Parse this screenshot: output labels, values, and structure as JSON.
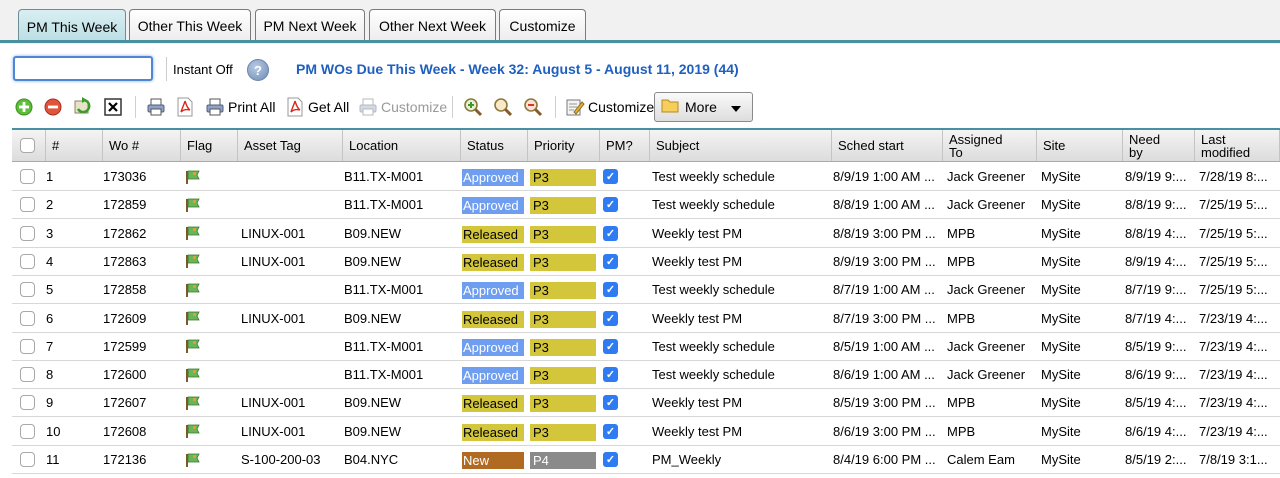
{
  "tabs": [
    {
      "label": "PM This Week",
      "active": true
    },
    {
      "label": "Other This Week",
      "active": false
    },
    {
      "label": "PM Next Week",
      "active": false
    },
    {
      "label": "Other Next Week",
      "active": false
    },
    {
      "label": "Customize",
      "active": false
    }
  ],
  "search": {
    "value": "",
    "placeholder": ""
  },
  "instant_label": "Instant Off",
  "help_label": "?",
  "title": "PM WOs Due This Week - Week 32: August 5 - August 11, 2019 (44)",
  "toolbar": {
    "print_all": "Print All",
    "get_all": "Get All",
    "customize_disabled": "Customize",
    "customize": "Customize",
    "more": "More"
  },
  "columns": {
    "num": "#",
    "wo": "Wo #",
    "flag": "Flag",
    "asset": "Asset Tag",
    "location": "Location",
    "status": "Status",
    "priority": "Priority",
    "pm": "PM?",
    "subject": "Subject",
    "sched": "Sched start",
    "assigned_1": "Assigned",
    "assigned_2": "To",
    "site": "Site",
    "need_1": "Need",
    "need_2": "by",
    "last_1": "Last",
    "last_2": "modified"
  },
  "colors": {
    "approved": "#6f9ef0",
    "released": "#d4c63b",
    "new": "#b06a22",
    "p3": "#d4c63b",
    "p4": "#8a8a8a",
    "accent": "#4a90a0",
    "title": "#1f5fbf"
  },
  "rows": [
    {
      "num": "1",
      "wo": "173036",
      "asset": "",
      "location": "B11.TX-M001",
      "status": "Approved",
      "priority": "P3",
      "subject": "Test weekly schedule",
      "sched": "8/9/19 1:00 AM ...",
      "assigned": "Jack Greener",
      "site": "MySite",
      "need": "8/9/19 9:...",
      "last": "7/28/19 8:..."
    },
    {
      "num": "2",
      "wo": "172859",
      "asset": "",
      "location": "B11.TX-M001",
      "status": "Approved",
      "priority": "P3",
      "subject": "Test weekly schedule",
      "sched": "8/8/19 1:00 AM ...",
      "assigned": "Jack Greener",
      "site": "MySite",
      "need": "8/8/19 9:...",
      "last": "7/25/19 5:..."
    },
    {
      "num": "3",
      "wo": "172862",
      "asset": "LINUX-001",
      "location": "B09.NEW",
      "status": "Released",
      "priority": "P3",
      "subject": "Weekly test PM",
      "sched": "8/8/19 3:00 PM ...",
      "assigned": "MPB",
      "site": "MySite",
      "need": "8/8/19 4:...",
      "last": "7/25/19 5:..."
    },
    {
      "num": "4",
      "wo": "172863",
      "asset": "LINUX-001",
      "location": "B09.NEW",
      "status": "Released",
      "priority": "P3",
      "subject": "Weekly test PM",
      "sched": "8/9/19 3:00 PM ...",
      "assigned": "MPB",
      "site": "MySite",
      "need": "8/9/19 4:...",
      "last": "7/25/19 5:..."
    },
    {
      "num": "5",
      "wo": "172858",
      "asset": "",
      "location": "B11.TX-M001",
      "status": "Approved",
      "priority": "P3",
      "subject": "Test weekly schedule",
      "sched": "8/7/19 1:00 AM ...",
      "assigned": "Jack Greener",
      "site": "MySite",
      "need": "8/7/19 9:...",
      "last": "7/25/19 5:..."
    },
    {
      "num": "6",
      "wo": "172609",
      "asset": "LINUX-001",
      "location": "B09.NEW",
      "status": "Released",
      "priority": "P3",
      "subject": "Weekly test PM",
      "sched": "8/7/19 3:00 PM ...",
      "assigned": "MPB",
      "site": "MySite",
      "need": "8/7/19 4:...",
      "last": "7/23/19 4:..."
    },
    {
      "num": "7",
      "wo": "172599",
      "asset": "",
      "location": "B11.TX-M001",
      "status": "Approved",
      "priority": "P3",
      "subject": "Test weekly schedule",
      "sched": "8/5/19 1:00 AM ...",
      "assigned": "Jack Greener",
      "site": "MySite",
      "need": "8/5/19 9:...",
      "last": "7/23/19 4:..."
    },
    {
      "num": "8",
      "wo": "172600",
      "asset": "",
      "location": "B11.TX-M001",
      "status": "Approved",
      "priority": "P3",
      "subject": "Test weekly schedule",
      "sched": "8/6/19 1:00 AM ...",
      "assigned": "Jack Greener",
      "site": "MySite",
      "need": "8/6/19 9:...",
      "last": "7/23/19 4:..."
    },
    {
      "num": "9",
      "wo": "172607",
      "asset": "LINUX-001",
      "location": "B09.NEW",
      "status": "Released",
      "priority": "P3",
      "subject": "Weekly test PM",
      "sched": "8/5/19 3:00 PM ...",
      "assigned": "MPB",
      "site": "MySite",
      "need": "8/5/19 4:...",
      "last": "7/23/19 4:..."
    },
    {
      "num": "10",
      "wo": "172608",
      "asset": "LINUX-001",
      "location": "B09.NEW",
      "status": "Released",
      "priority": "P3",
      "subject": "Weekly test PM",
      "sched": "8/6/19 3:00 PM ...",
      "assigned": "MPB",
      "site": "MySite",
      "need": "8/6/19 4:...",
      "last": "7/23/19 4:..."
    },
    {
      "num": "11",
      "wo": "172136",
      "asset": "S-100-200-03",
      "location": "B04.NYC",
      "status": "New",
      "priority": "P4",
      "subject": "PM_Weekly",
      "sched": "8/4/19 6:00 PM ...",
      "assigned": "Calem Eam",
      "site": "MySite",
      "need": "8/5/19 2:...",
      "last": "7/8/19 3:1..."
    }
  ]
}
